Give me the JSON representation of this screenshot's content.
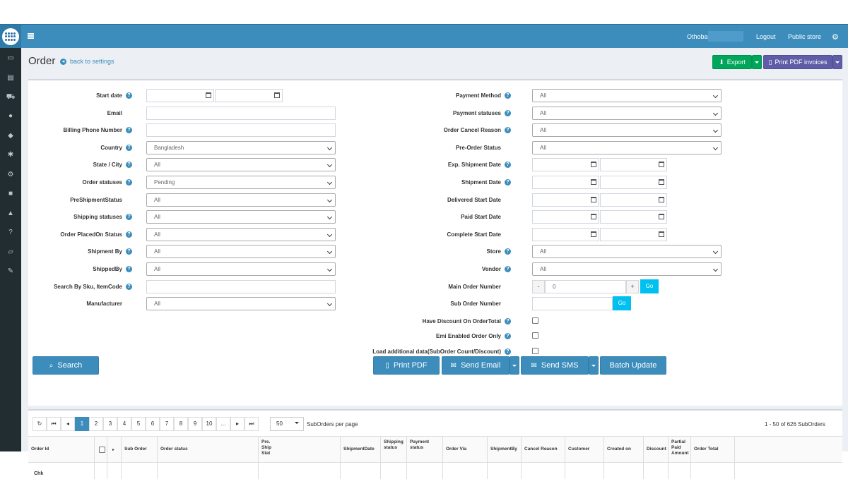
{
  "topbar": {
    "user": "Othoba",
    "logout": "Logout",
    "public_store": "Public store"
  },
  "page": {
    "title": "Order",
    "back_link": "back to settings"
  },
  "actions": {
    "export": "Export",
    "print_pdf_invoices": "Print PDF invoices"
  },
  "filters_left": [
    {
      "label": "Start date",
      "help": true,
      "kind": "daterange"
    },
    {
      "label": "Email",
      "help": false,
      "kind": "text",
      "value": ""
    },
    {
      "label": "Billing Phone Number",
      "help": true,
      "kind": "text",
      "value": ""
    },
    {
      "label": "Country",
      "help": true,
      "kind": "select",
      "value": "Bangladesh"
    },
    {
      "label": "State / City",
      "help": true,
      "kind": "select",
      "value": "All"
    },
    {
      "label": "Order statuses",
      "help": true,
      "kind": "select",
      "value": "Pending"
    },
    {
      "label": "PreShipmentStatus",
      "help": false,
      "kind": "select",
      "value": "All"
    },
    {
      "label": "Shipping statuses",
      "help": true,
      "kind": "select",
      "value": "All"
    },
    {
      "label": "Order PlacedOn Status",
      "help": true,
      "kind": "select",
      "value": "All"
    },
    {
      "label": "Shipment By",
      "help": true,
      "kind": "select",
      "value": "All"
    },
    {
      "label": "ShippedBy",
      "help": true,
      "kind": "select",
      "value": "All"
    },
    {
      "label": "Search By Sku, ItemCode",
      "help": true,
      "kind": "text",
      "value": ""
    },
    {
      "label": "Manufacturer",
      "help": false,
      "kind": "select",
      "value": "All"
    }
  ],
  "filters_right": [
    {
      "label": "Payment Method",
      "help": true,
      "kind": "select",
      "value": "All"
    },
    {
      "label": "Payment statuses",
      "help": true,
      "kind": "select",
      "value": "All"
    },
    {
      "label": "Order Cancel Reason",
      "help": true,
      "kind": "select",
      "value": "All"
    },
    {
      "label": "Pre-Order Status",
      "help": false,
      "kind": "select",
      "value": "All"
    },
    {
      "label": "Exp. Shipment Date",
      "help": true,
      "kind": "daterange"
    },
    {
      "label": "Shipment Date",
      "help": true,
      "kind": "daterange"
    },
    {
      "label": "Delivered Start Date",
      "help": false,
      "kind": "daterange"
    },
    {
      "label": "Paid Start Date",
      "help": false,
      "kind": "daterange"
    },
    {
      "label": "Complete Start Date",
      "help": false,
      "kind": "daterange"
    },
    {
      "label": "Store",
      "help": true,
      "kind": "select",
      "value": "All"
    },
    {
      "label": "Vendor",
      "help": true,
      "kind": "select",
      "value": "All"
    },
    {
      "label": "Main Order Number",
      "help": false,
      "kind": "stepper",
      "value": "0",
      "minus": "-",
      "plus": "+",
      "go": "Go"
    },
    {
      "label": "Sub Order Number",
      "help": false,
      "kind": "textgo",
      "value": "",
      "go": "Go"
    },
    {
      "label": "Have Discount On OrderTotal",
      "help": true,
      "kind": "checkbox"
    },
    {
      "label": "Emi Enabled Order Only",
      "help": true,
      "kind": "checkbox"
    },
    {
      "label": "Load additional data(SubOrder Count/Discount)",
      "help": true,
      "kind": "checkbox"
    }
  ],
  "buttons": {
    "search": "Search",
    "print_pdf": "Print PDF",
    "send_email": "Send Email",
    "send_sms": "Send SMS",
    "batch_update": "Batch Update"
  },
  "grid": {
    "pages": [
      "1",
      "2",
      "3",
      "4",
      "5",
      "6",
      "7",
      "8",
      "9",
      "10",
      "..."
    ],
    "active_page": "1",
    "page_size": "50",
    "page_size_label": "SubOrders per page",
    "info": "1 - 50 of 626 SubOrders",
    "columns": [
      "Order Id",
      "",
      "",
      "Sub Order",
      "Order status",
      "Pre.\nShip\nStat",
      "ShipmentDate",
      "Shipping\nstatus",
      "Payment\nstatus",
      "Order Via",
      "ShipmentBy",
      "Cancel Reason",
      "Customer",
      "Created on",
      "Discount",
      "Partial\nPaid\nAmount",
      "Order Total"
    ],
    "first_cell": "Chk"
  }
}
